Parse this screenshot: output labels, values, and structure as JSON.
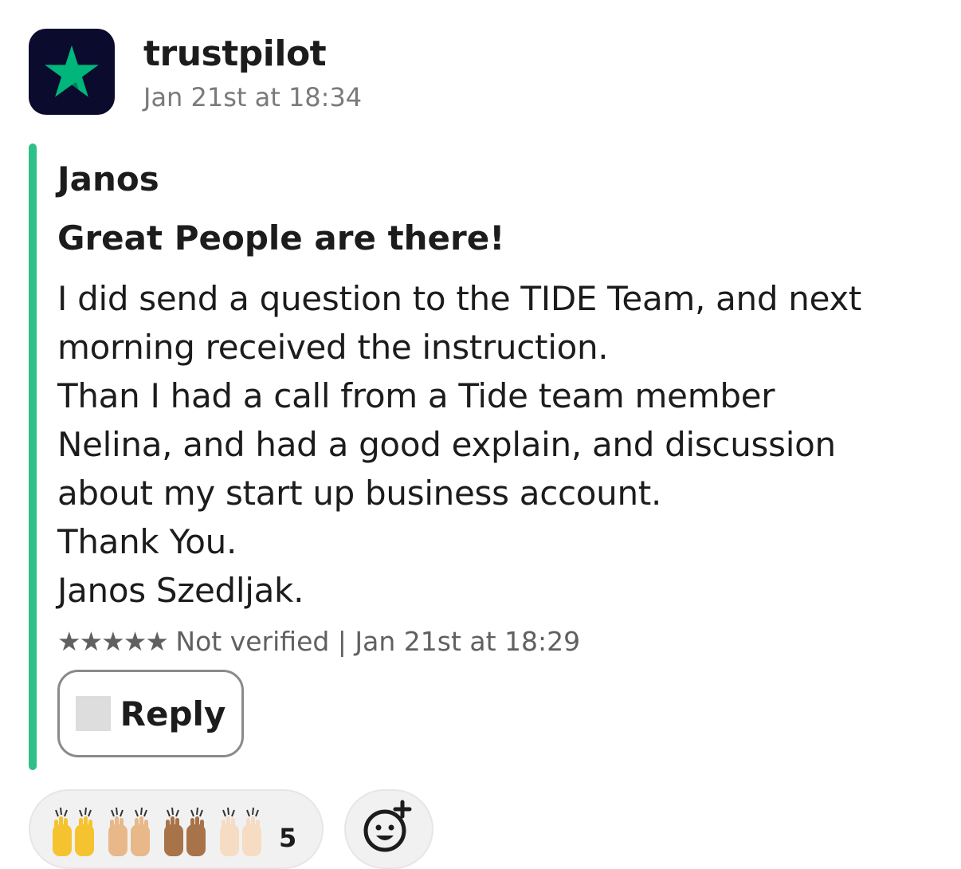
{
  "app": {
    "sender": "trustpilot",
    "posted_at": "Jan 21st at 18:34",
    "avatar_icon": "trustpilot-star-icon",
    "avatar_bg": "#0b0b2e",
    "star_color": "#00b67a"
  },
  "attachment": {
    "accent_color": "#2fbf8b",
    "author": "Janos",
    "title": "Great People are there!",
    "body": "I did send a question to the TIDE Team, and next\nmorning received the instruction.\nThan I had a call from a Tide team member\nNelina, and had a good explain, and discussion\nabout my start up business account.\nThank You.\nJanos Szedljak.",
    "stars": "★★★★★",
    "meta": " Not verified | Jan 21st at 18:29",
    "reply_label": "Reply",
    "reply_icon": "reply-icon"
  },
  "reactions": {
    "emoji": "raised-hands",
    "skin_tones": [
      "#f6c330",
      "#e8b889",
      "#a9734a",
      "#f6dcc3"
    ],
    "count": "5",
    "add_icon": "add-reaction-icon"
  }
}
